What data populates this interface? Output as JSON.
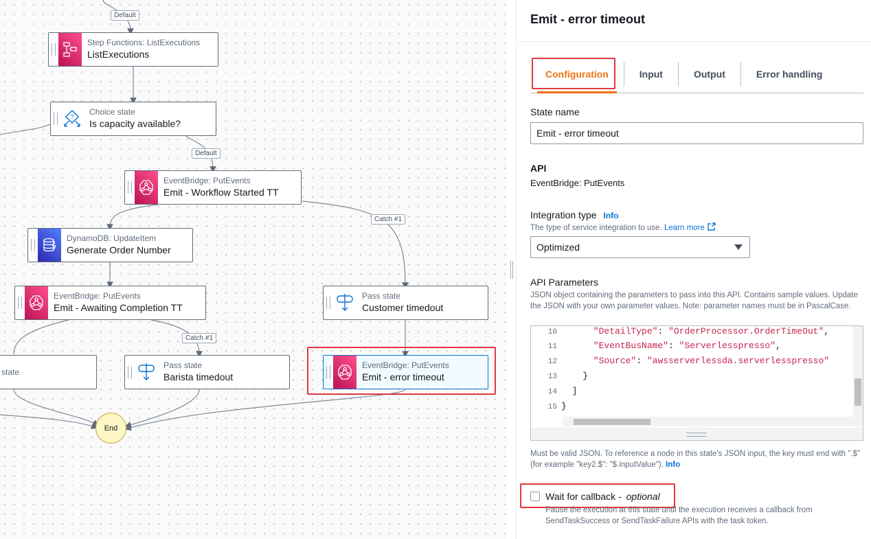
{
  "canvas": {
    "nodes": [
      {
        "type": "Step Functions: ListExecutions",
        "name": "ListExecutions",
        "icon": "step-functions-icon"
      },
      {
        "type": "Choice state",
        "name": "Is capacity available?",
        "icon": "choice-icon"
      },
      {
        "type": "EventBridge: PutEvents",
        "name": "Emit - Workflow Started TT",
        "icon": "eventbridge-icon"
      },
      {
        "type": "DynamoDB: UpdateItem",
        "name": "Generate Order Number",
        "icon": "dynamodb-icon"
      },
      {
        "type": "EventBridge: PutEvents",
        "name": "Emit - Awaiting Completion TT",
        "icon": "eventbridge-icon"
      },
      {
        "type": "Pass state",
        "name": "Customer timedout",
        "icon": "pass-icon"
      },
      {
        "type": "state",
        "name": "",
        "icon": ""
      },
      {
        "type": "Pass state",
        "name": "Barista timedout",
        "icon": "pass-icon"
      },
      {
        "type": "EventBridge: PutEvents",
        "name": "Emit - error timeout",
        "icon": "eventbridge-icon"
      }
    ],
    "edge_labels": [
      "Default",
      "Default",
      "Catch #1",
      "Catch #1"
    ],
    "end_label": "End"
  },
  "panel": {
    "title": "Emit - error timeout",
    "tabs": [
      "Configuration",
      "Input",
      "Output",
      "Error handling"
    ],
    "active_tab": "Configuration",
    "state_name_label": "State name",
    "state_name_value": "Emit - error timeout",
    "api_label": "API",
    "api_value": "EventBridge: PutEvents",
    "integration_label": "Integration type",
    "info": "Info",
    "integration_desc": "The type of service integration to use.",
    "learn_more": "Learn more",
    "integration_value": "Optimized",
    "api_params_label": "API Parameters",
    "api_params_desc": "JSON object containing the parameters to pass into this API. Contains sample values. Update the JSON with your own parameter values. Note: parameter names must be in PascalCase.",
    "code_lines": [
      {
        "n": "10",
        "indent": "      ",
        "key": "\"DetailType\"",
        "sep": ": ",
        "val": "\"OrderProcessor.OrderTimeOut\"",
        "end": ","
      },
      {
        "n": "11",
        "indent": "      ",
        "key": "\"EventBusName\"",
        "sep": ": ",
        "val": "\"Serverlesspresso\"",
        "end": ","
      },
      {
        "n": "12",
        "indent": "      ",
        "key": "\"Source\"",
        "sep": ": ",
        "val": "\"awsserverlessda.serverlesspresso\"",
        "end": ""
      },
      {
        "n": "13",
        "indent": "    ",
        "key": "}",
        "sep": "",
        "val": "",
        "end": ""
      },
      {
        "n": "14",
        "indent": "  ",
        "key": "]",
        "sep": "",
        "val": "",
        "end": ""
      },
      {
        "n": "15",
        "indent": "",
        "key": "}",
        "sep": "",
        "val": "",
        "end": ""
      }
    ],
    "json_note": "Must be valid JSON. To reference a node in this state's JSON input, the key must end with \".$\" (for example \"key2.$\": \"$.inputValue\").",
    "callback_label": "Wait for callback -",
    "callback_optional": "optional",
    "callback_checked": false,
    "callback_desc": "Pause the execution at this state until the execution receives a callback from SendTaskSuccess or SendTaskFailure APIs with the task token."
  },
  "colors": {
    "accent": "#ec7211",
    "link": "#0972d3",
    "highlight_box": "#e0383e",
    "eventbridge": "#e7157b",
    "dynamodb": "#3b48cc"
  }
}
